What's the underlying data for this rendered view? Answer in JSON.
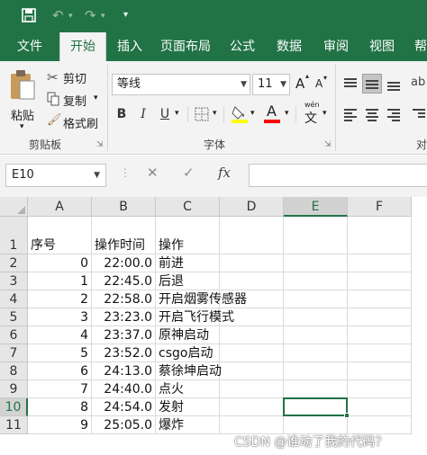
{
  "quick_access": {
    "icons": [
      "save-icon",
      "undo-icon",
      "redo-icon",
      "customize-icon"
    ]
  },
  "tabs": [
    {
      "label": "文件",
      "active": false
    },
    {
      "label": "开始",
      "active": true
    },
    {
      "label": "插入",
      "active": false
    },
    {
      "label": "页面布局",
      "active": false
    },
    {
      "label": "公式",
      "active": false
    },
    {
      "label": "数据",
      "active": false
    },
    {
      "label": "审阅",
      "active": false
    },
    {
      "label": "视图",
      "active": false
    },
    {
      "label": "帮",
      "active": false
    }
  ],
  "ribbon": {
    "clipboard": {
      "paste_label": "粘贴",
      "cut_label": "剪切",
      "copy_label": "复制",
      "format_painter_label": "格式刷",
      "group_label": "剪贴板"
    },
    "font": {
      "font_name": "等线",
      "font_size": "11",
      "grow_label": "A",
      "shrink_label": "A",
      "bold_label": "B",
      "italic_label": "I",
      "underline_label": "U",
      "phonetic_label": "wén",
      "phonetic_char": "文",
      "font_color_label": "A",
      "group_label": "字体"
    },
    "alignment": {
      "group_label_partial": "对"
    }
  },
  "formula_bar": {
    "name_box": "E10",
    "cancel_symbol": "✕",
    "enter_symbol": "✓",
    "fx_label": "fx",
    "value": ""
  },
  "sheet": {
    "columns": [
      "A",
      "B",
      "C",
      "D",
      "E",
      "F"
    ],
    "selected_column": "E",
    "selected_row": "10",
    "header_row": {
      "A": "序号",
      "B": "操作时间",
      "C": "操作"
    },
    "rows": [
      {
        "row": "1",
        "A": "序号",
        "B": "操作时间",
        "C": "操作"
      },
      {
        "row": "2",
        "A": "0",
        "B": "22:00.0",
        "C": "前进"
      },
      {
        "row": "3",
        "A": "1",
        "B": "22:45.0",
        "C": "后退"
      },
      {
        "row": "4",
        "A": "2",
        "B": "22:58.0",
        "C": "开启烟雾传感器"
      },
      {
        "row": "5",
        "A": "3",
        "B": "23:23.0",
        "C": "开启飞行模式"
      },
      {
        "row": "6",
        "A": "4",
        "B": "23:37.0",
        "C": "原神启动"
      },
      {
        "row": "7",
        "A": "5",
        "B": "23:52.0",
        "C": "csgo启动"
      },
      {
        "row": "8",
        "A": "6",
        "B": "24:13.0",
        "C": "蔡徐坤启动"
      },
      {
        "row": "9",
        "A": "7",
        "B": "24:40.0",
        "C": "点火"
      },
      {
        "row": "10",
        "A": "8",
        "B": "24:54.0",
        "C": "发射"
      },
      {
        "row": "11",
        "A": "9",
        "B": "25:05.0",
        "C": "爆炸"
      }
    ]
  },
  "watermark": "CSDN @谁动了我的代码？",
  "colors": {
    "brand": "#217346",
    "ribbon_bg": "#f3f3f3",
    "highlight_yellow": "#ffff00",
    "font_red": "#ff0000"
  }
}
